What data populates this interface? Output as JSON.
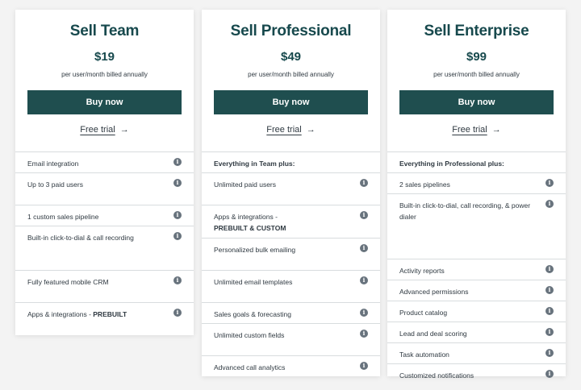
{
  "plans": [
    {
      "title": "Sell Team",
      "price": "$19",
      "period": "per user/month billed annually",
      "buy_label": "Buy now",
      "trial_label": "Free trial",
      "features": [
        {
          "text": "Email integration"
        },
        {
          "text": "Up to 3 paid users"
        },
        {
          "text": "1 custom sales pipeline"
        },
        {
          "text": "Built-in click-to-dial & call recording"
        },
        {
          "text": "Fully featured mobile CRM"
        },
        {
          "text": "Apps & integrations - ",
          "bold": "PREBUILT"
        }
      ]
    },
    {
      "title": "Sell Professional",
      "price": "$49",
      "period": "per user/month billed annually",
      "buy_label": "Buy now",
      "trial_label": "Free trial",
      "header": "Everything in Team plus:",
      "features": [
        {
          "text": "Unlimited paid users"
        },
        {
          "text": "Apps & integrations -",
          "bold": "PREBUILT & CUSTOM"
        },
        {
          "text": "Personalized bulk emailing"
        },
        {
          "text": "Unlimited email templates"
        },
        {
          "text": "Sales goals & forecasting"
        },
        {
          "text": "Unlimited custom fields"
        },
        {
          "text": "Advanced call analytics"
        }
      ]
    },
    {
      "title": "Sell Enterprise",
      "price": "$99",
      "period": "per user/month billed annually",
      "buy_label": "Buy now",
      "trial_label": "Free trial",
      "header": "Everything in Professional plus:",
      "features": [
        {
          "text": "2 sales pipelines"
        },
        {
          "text": "Built-in click-to-dial, call recording, & power dialer"
        },
        {
          "text": "Activity reports"
        },
        {
          "text": "Advanced permissions"
        },
        {
          "text": "Product catalog"
        },
        {
          "text": "Lead and deal scoring"
        },
        {
          "text": "Task automation"
        },
        {
          "text": "Customized notifications"
        }
      ]
    }
  ],
  "trial_arrow": "→",
  "info_glyph": "i",
  "icons": {
    "info": "info-icon",
    "arrow": "arrow-right-icon"
  },
  "colors": {
    "brand": "#17494d",
    "button": "#1f4e4f",
    "background": "#f3f3f3",
    "divider": "#d8dcde",
    "info": "#68737d"
  }
}
